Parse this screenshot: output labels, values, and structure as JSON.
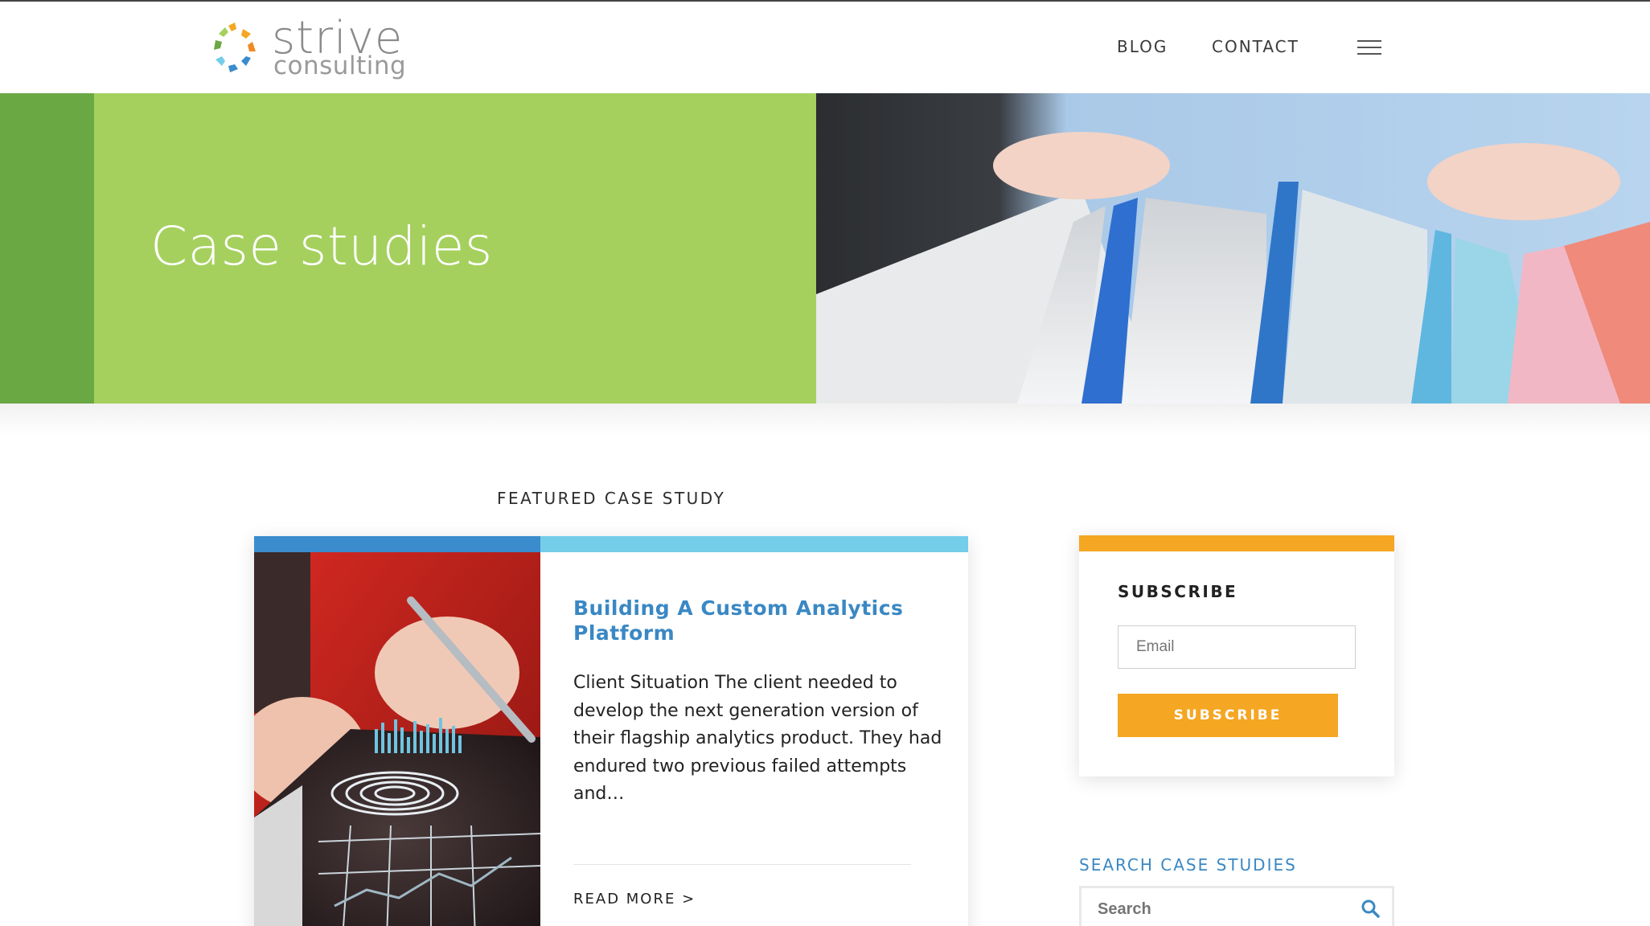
{
  "header": {
    "logo_word": "strive",
    "logo_sub": "consulting",
    "nav": [
      {
        "label": "BLOG"
      },
      {
        "label": "CONTACT"
      }
    ],
    "menu_icon": "hamburger-menu-icon"
  },
  "hero": {
    "title": "Case studies",
    "colors": {
      "dark_green": "#6aa843",
      "green": "#a5d05e"
    }
  },
  "featured": {
    "label": "FEATURED CASE STUDY",
    "title": "Building A Custom Analytics Platform",
    "excerpt": "Client Situation The client needed to develop the next generation version of their flagship analytics product. They had endured two previous failed attempts and…",
    "read_more": "READ MORE >",
    "colors": {
      "bar_blue": "#3a8ccc",
      "bar_light_blue": "#74cde9",
      "title": "#3a88c4"
    }
  },
  "subscribe": {
    "title": "SUBSCRIBE",
    "email_placeholder": "Email",
    "button_label": "SUBSCRIBE",
    "accent": "#f5a623"
  },
  "search": {
    "label": "SEARCH CASE STUDIES",
    "placeholder": "Search",
    "icon": "search-icon"
  }
}
